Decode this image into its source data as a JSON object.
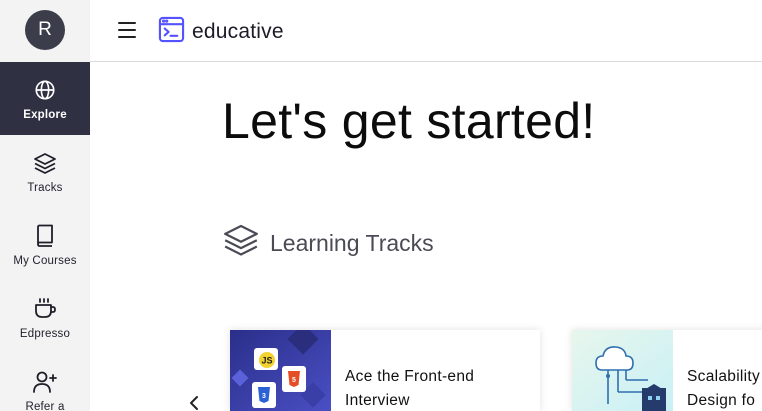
{
  "sidebar": {
    "avatar_letter": "R",
    "items": [
      {
        "label": "Explore",
        "icon": "globe-icon",
        "active": true
      },
      {
        "label": "Tracks",
        "icon": "layers-icon"
      },
      {
        "label": "My Courses",
        "icon": "book-icon"
      },
      {
        "label": "Edpresso",
        "icon": "coffee-icon"
      },
      {
        "label": "Refer a",
        "icon": "add-user-icon"
      }
    ]
  },
  "header": {
    "logo_text": "educative",
    "menu_icon": "hamburger-icon",
    "logo_icon": "terminal-window-icon"
  },
  "main": {
    "title": "Let's get started!",
    "section_title": "Learning Tracks",
    "section_icon": "layers-icon",
    "cards": [
      {
        "line1": "Ace the Front-end",
        "line2": "Interview"
      },
      {
        "line1": "Scalability",
        "line2": "Design fo"
      }
    ],
    "prev_icon": "chevron-left-icon"
  },
  "colors": {
    "sidebar_bg": "#f3f3f3",
    "sidebar_active_bg": "#2f3042",
    "brand": "#5553ff",
    "text": "#0f0f0f"
  }
}
